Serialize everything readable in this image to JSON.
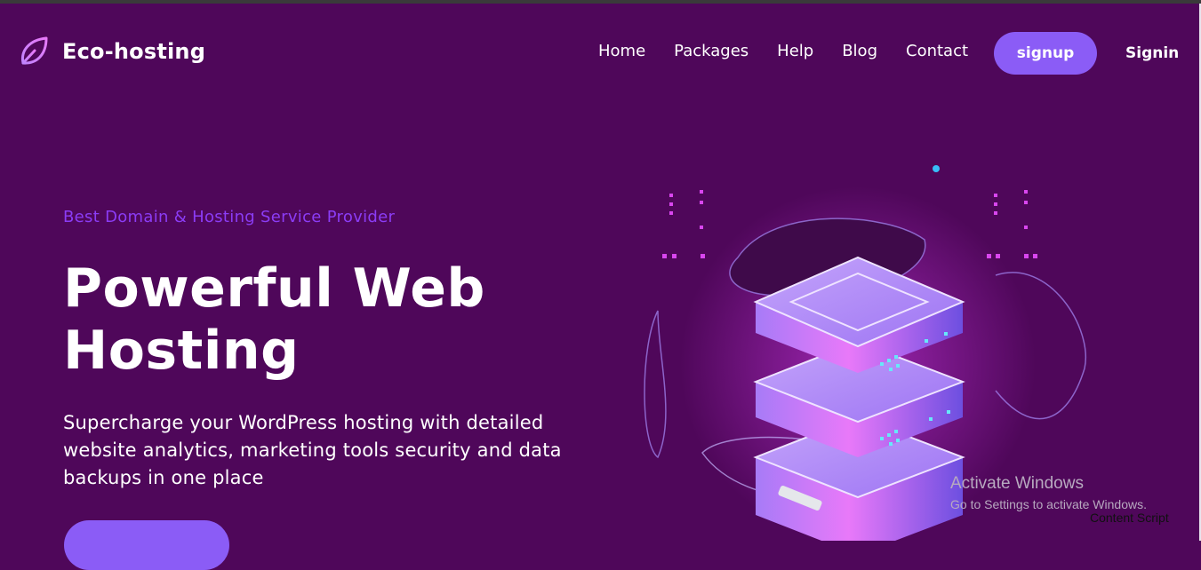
{
  "brand": {
    "name": "Eco-hosting",
    "icon": "leaf-icon",
    "accent": "#8b5cf6"
  },
  "nav": {
    "items": [
      "Home",
      "Packages",
      "Help",
      "Blog",
      "Contact"
    ],
    "signup_label": "signup",
    "signin_label": "Signin"
  },
  "hero": {
    "subtitle": "Best Domain & Hosting Service Provider",
    "title": "Powerful Web Hosting",
    "description": "Supercharge your WordPress hosting with detailed website analytics, marketing tools security and data backups in one place",
    "illustration": "server-stack-illustration"
  },
  "watermark": {
    "title": "Activate Windows",
    "subtitle": "Go to Settings to activate Windows."
  },
  "overlay_label": "Content Script"
}
